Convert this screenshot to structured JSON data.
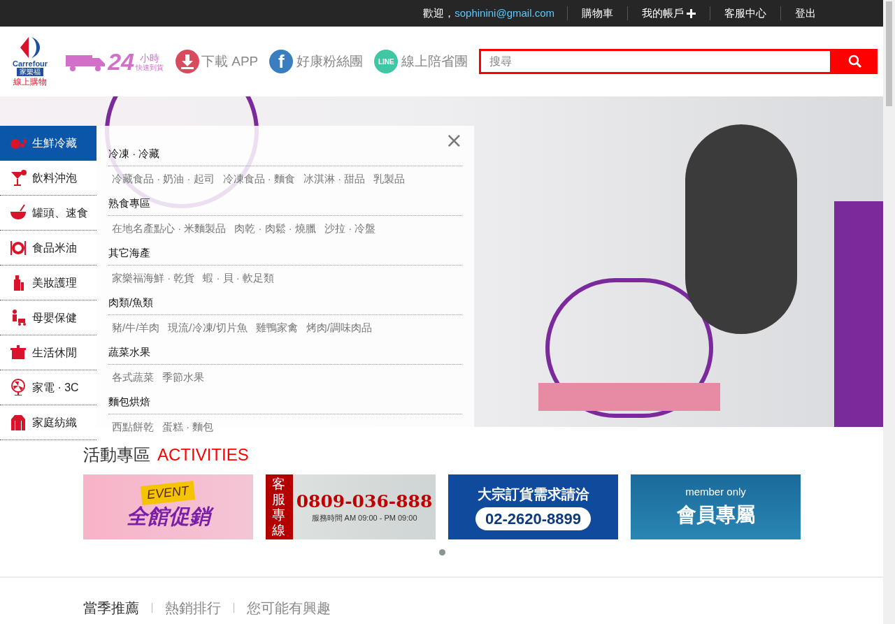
{
  "top_bar": {
    "welcome": "歡迎，",
    "email": "sophinini@gmail.com",
    "links": [
      {
        "label": "購物車",
        "kind": "plain"
      },
      {
        "label": "我的帳戶",
        "kind": "plus"
      },
      {
        "label": "客服中心",
        "kind": "plain"
      },
      {
        "label": "登出",
        "kind": "plain"
      }
    ]
  },
  "logo": {
    "brand": "Carrefour",
    "cn_name": "家樂福",
    "subtitle": "線上購物"
  },
  "header_links": [
    {
      "kind": "delivery",
      "big": "24",
      "small": "小時",
      "tiny": "快速到貨"
    },
    {
      "kind": "download",
      "label": "下載 APP"
    },
    {
      "kind": "facebook",
      "glyph": "f",
      "label": "好康粉絲團"
    },
    {
      "kind": "line",
      "glyph": "LINE",
      "label": "線上陪省團"
    }
  ],
  "search": {
    "placeholder": "搜尋"
  },
  "categories": [
    {
      "label": "生鮮冷藏",
      "selected": true
    },
    {
      "label": "飲料沖泡",
      "selected": false
    },
    {
      "label": "罐頭、速食",
      "selected": false
    },
    {
      "label": "食品米油",
      "selected": false
    },
    {
      "label": "美妝護理",
      "selected": false
    },
    {
      "label": "母嬰保健",
      "selected": false
    },
    {
      "label": "生活休閒",
      "selected": false
    },
    {
      "label": "家電 · 3C",
      "selected": false
    },
    {
      "label": "家庭紡織",
      "selected": false
    }
  ],
  "submenu": {
    "close": "×",
    "sections": [
      {
        "title": "冷凍 · 冷藏",
        "links": [
          "冷藏食品 · 奶油 · 起司",
          "冷凍食品 · 麵食",
          "冰淇淋 · 甜品",
          "乳製品"
        ]
      },
      {
        "title": "熟食專區",
        "links": [
          "在地名產點心 · 米麵製品",
          "肉乾 · 肉鬆 · 燒臘",
          "沙拉 · 冷盤"
        ]
      },
      {
        "title": "其它海產",
        "links": [
          "家樂福海鮮 · 乾貨",
          "蝦 · 貝 · 軟足類"
        ]
      },
      {
        "title": "肉類/魚類",
        "links": [
          "豬/牛/羊肉",
          "現流/冷凍/切片魚",
          "雞鴨家禽",
          "烤肉/調味肉品"
        ]
      },
      {
        "title": "蔬菜水果",
        "links": [
          "各式蔬菜",
          "季節水果"
        ]
      },
      {
        "title": "麵包烘焙",
        "links": [
          "西點餅乾",
          "蛋糕 · 麵包"
        ]
      }
    ]
  },
  "activities": {
    "title": "活動專區",
    "title_en": "ACTIVITIES",
    "tiles": [
      {
        "kind": "event",
        "tag": "EVENT",
        "text": "全館促銷"
      },
      {
        "kind": "service",
        "side": "客服專線",
        "phone": "0809-036-888",
        "hours": "服務時間 AM 09:00 - PM 09:00"
      },
      {
        "kind": "bulk",
        "text": "大宗訂貨需求請洽",
        "phone": "02-2620-8899"
      },
      {
        "kind": "member",
        "tag": "member only",
        "text": "會員專屬"
      }
    ]
  },
  "product_tabs": [
    {
      "label": "當季推薦",
      "selected": true
    },
    {
      "label": "熱銷排行",
      "selected": false
    },
    {
      "label": "您可能有興趣",
      "selected": false
    }
  ]
}
